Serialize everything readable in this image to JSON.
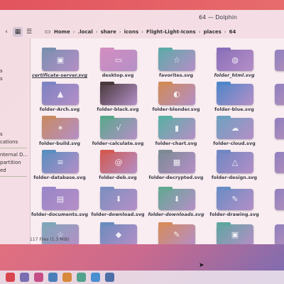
{
  "window": {
    "title": "64 — Dolphin"
  },
  "toolbar": {
    "view_icons": "icons-view-icon",
    "view_details": "details-view-icon"
  },
  "breadcrumbs": [
    "Home",
    ".local",
    "share",
    "icons",
    "Flight-Light-Icons",
    "places",
    "64"
  ],
  "sidebar": {
    "items": [
      "s",
      "s",
      "",
      "s",
      "cations",
      "nternal D...",
      "partition",
      "ed"
    ]
  },
  "files": [
    {
      "name": "certificate-server.svg",
      "color": "#7a8fb0",
      "glyph": "▣",
      "style": "under"
    },
    {
      "name": "desktop.svg",
      "color": "#d28ec0",
      "glyph": "▭",
      "style": ""
    },
    {
      "name": "favorites.svg",
      "color": "#5fa9a8",
      "glyph": "☆",
      "style": ""
    },
    {
      "name": "folder_html.svg",
      "color": "#8a6fb9",
      "glyph": "◍",
      "style": "italic"
    },
    {
      "name": "folder-Arch.svg",
      "color": "#7e83c2",
      "glyph": "▲",
      "style": ""
    },
    {
      "name": "folder-black.svg",
      "color": "#4a3a3e",
      "glyph": "",
      "style": ""
    },
    {
      "name": "folder-blender.svg",
      "color": "#cf8a58",
      "glyph": "◐",
      "style": ""
    },
    {
      "name": "folder-blue.svg",
      "color": "#4f86c9",
      "glyph": "",
      "style": ""
    },
    {
      "name": "folder-build.svg",
      "color": "#c78a63",
      "glyph": "✶",
      "style": ""
    },
    {
      "name": "folder-calculate.svg",
      "color": "#5aa88c",
      "glyph": "√",
      "style": ""
    },
    {
      "name": "folder-chart.svg",
      "color": "#5ab0a4",
      "glyph": "▮",
      "style": ""
    },
    {
      "name": "folder-cloud.svg",
      "color": "#6fa0c0",
      "glyph": "☁",
      "style": ""
    },
    {
      "name": "folder-database.svg",
      "color": "#5b8ec0",
      "glyph": "≡",
      "style": ""
    },
    {
      "name": "folder-deb.svg",
      "color": "#d15a52",
      "glyph": "@",
      "style": ""
    },
    {
      "name": "folder-decrypted.svg",
      "color": "#7c8a94",
      "glyph": "▦",
      "style": ""
    },
    {
      "name": "folder-design.svg",
      "color": "#6f87c3",
      "glyph": "△",
      "style": ""
    },
    {
      "name": "folder-documents.svg",
      "color": "#9a86c8",
      "glyph": "▤",
      "style": ""
    },
    {
      "name": "folder-download.svg",
      "color": "#7c8fbf",
      "glyph": "⬇",
      "style": ""
    },
    {
      "name": "folder-downloads.svg",
      "color": "#63a893",
      "glyph": "⬇",
      "style": "italic"
    },
    {
      "name": "folder-drawing.svg",
      "color": "#6a8cc4",
      "glyph": "✎",
      "style": ""
    },
    {
      "name": "",
      "color": "#7fa7b8",
      "glyph": "☆",
      "style": ""
    },
    {
      "name": "",
      "color": "#6c8bbd",
      "glyph": "◆",
      "style": ""
    },
    {
      "name": "",
      "color": "#d58b5c",
      "glyph": "✎",
      "style": ""
    },
    {
      "name": "",
      "color": "#5fa6a1",
      "glyph": "▣",
      "style": ""
    }
  ],
  "status": {
    "summary": "117 Files (1.3 MiB)"
  },
  "taskbar": {
    "icons": [
      "#d9464f",
      "#7a6fb0",
      "#c44f86",
      "#4a7fb8",
      "#d78a3c",
      "#52a28e",
      "#4a8fd0",
      "#4f6fa8"
    ]
  }
}
